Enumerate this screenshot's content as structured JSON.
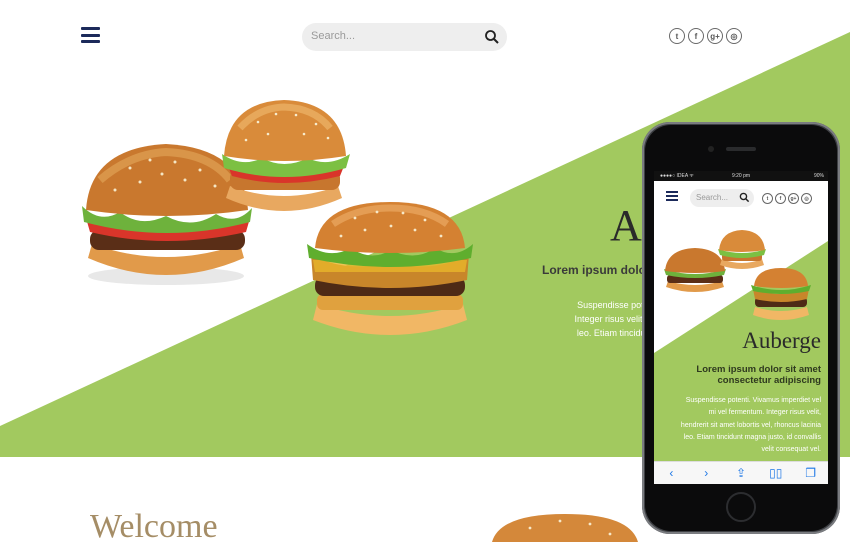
{
  "header": {
    "search_placeholder": "Search...",
    "social_icons": [
      "twitter-icon",
      "facebook-icon",
      "google-plus-icon",
      "dribbble-icon"
    ],
    "social_glyphs": [
      "t",
      "f",
      "g+",
      "◎"
    ]
  },
  "hero": {
    "title": "Au",
    "subtitle": "Lorem ipsum dolo",
    "paragraph_lines": [
      "Suspendisse potenti. Vivamus in",
      "Integer risus velit, hendrerit sit an",
      "leo. Etiam tincidunt magna justo,"
    ]
  },
  "welcome": {
    "heading": "Welcome"
  },
  "phone": {
    "status": {
      "carrier": "●●●●○ IDEA ᯤ",
      "time": "9:20 pm",
      "battery": "90%"
    },
    "search_placeholder": "Search...",
    "title": "Auberge",
    "subtitle_lines": [
      "Lorem ipsum dolor sit amet",
      "consectetur adipiscing"
    ],
    "paragraph_lines": [
      "Suspendisse potenti. Vivamus imperdiet vel",
      "mi vel fermentum. Integer risus velit,",
      "hendrerit sit amet lobortis vel, rhoncus lacinia",
      "leo. Etiam tincidunt magna justo, id convallis",
      "velit consequat vel."
    ],
    "toolbar": {
      "back": "‹",
      "forward": "›",
      "share": "⇪",
      "bookmarks": "▯▯",
      "tabs": "❐"
    }
  },
  "colors": {
    "accent_green": "#a2c95f",
    "navy": "#1c2a5a",
    "welcome_gold": "#a58d66"
  }
}
